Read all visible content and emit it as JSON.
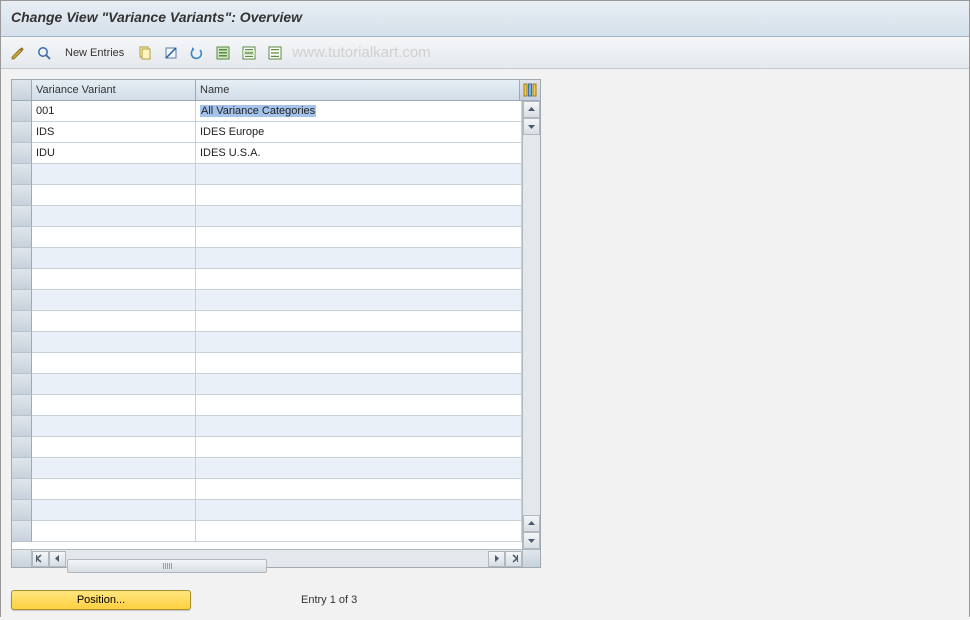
{
  "title": "Change View \"Variance Variants\": Overview",
  "toolbar": {
    "new_entries": "New Entries",
    "watermark": "www.tutorialkart.com"
  },
  "table": {
    "headers": {
      "variance_variant": "Variance Variant",
      "name": "Name"
    },
    "rows": [
      {
        "vv": "001",
        "name": "All Variance Categories",
        "selected": true
      },
      {
        "vv": "IDS",
        "name": "IDES Europe",
        "selected": false
      },
      {
        "vv": "IDU",
        "name": "IDES U.S.A.",
        "selected": false
      }
    ],
    "visible_row_count": 21
  },
  "footer": {
    "position_btn": "Position...",
    "entry_label": "Entry 1 of 3"
  }
}
